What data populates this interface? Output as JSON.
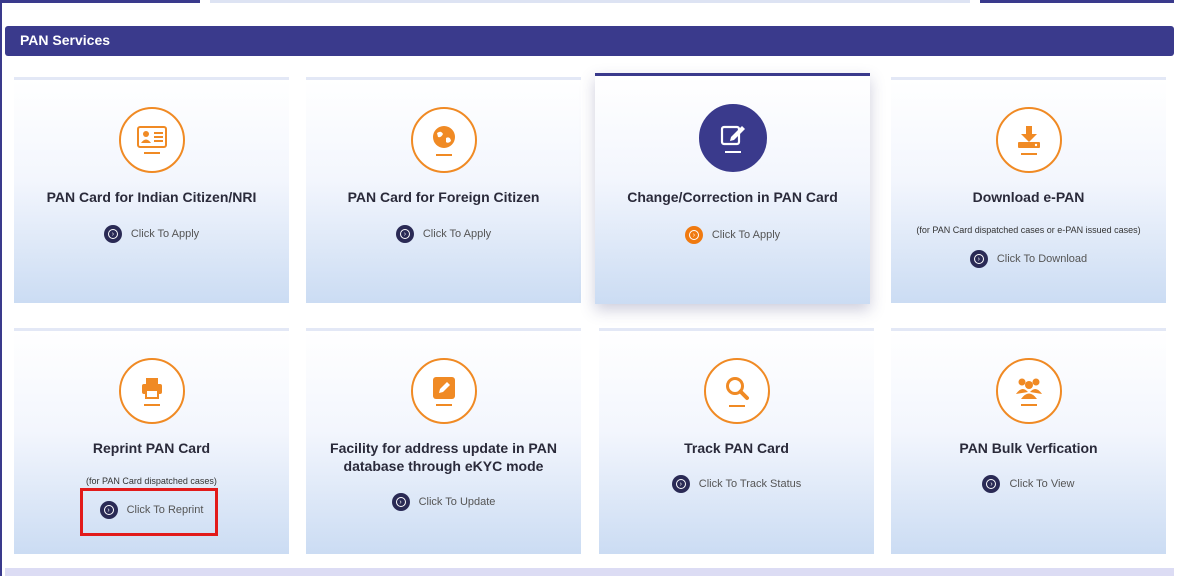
{
  "section": {
    "title": "PAN Services"
  },
  "colors": {
    "brand": "#3a3a8c",
    "accent": "#f08a24",
    "highlight": "#e21a1a"
  },
  "cards": [
    {
      "icon": "id-card-icon",
      "title": "PAN Card for Indian Citizen/NRI",
      "note": "",
      "action": "Click To Apply"
    },
    {
      "icon": "globe-icon",
      "title": "PAN Card for Foreign Citizen",
      "note": "",
      "action": "Click To Apply"
    },
    {
      "icon": "edit-icon",
      "title": "Change/Correction in PAN Card",
      "note": "",
      "action": "Click To Apply"
    },
    {
      "icon": "download-icon",
      "title": "Download e-PAN",
      "note": "(for PAN Card dispatched cases or e-PAN issued cases)",
      "action": "Click To Download"
    },
    {
      "icon": "printer-icon",
      "title": "Reprint PAN Card",
      "note": "(for PAN Card dispatched cases)",
      "action": "Click To Reprint"
    },
    {
      "icon": "pencil-icon",
      "title": "Facility for address update in PAN database through eKYC mode",
      "note": "",
      "action": "Click To Update"
    },
    {
      "icon": "search-icon",
      "title": "Track PAN Card",
      "note": "",
      "action": "Click To Track Status"
    },
    {
      "icon": "users-icon",
      "title": "PAN Bulk Verfication",
      "note": "",
      "action": "Click To View"
    }
  ]
}
